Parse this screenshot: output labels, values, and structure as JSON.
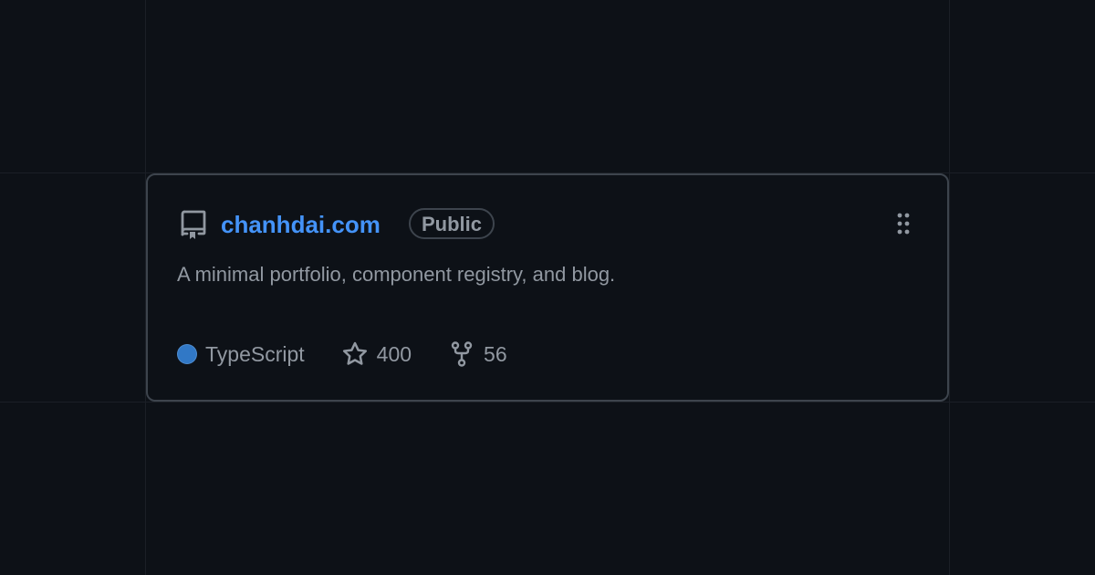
{
  "repo": {
    "name": "chanhdai.com",
    "visibility": "Public",
    "description": "A minimal portfolio, component registry, and blog.",
    "language": "TypeScript",
    "stars": "400",
    "forks": "56"
  },
  "colors": {
    "background": "#0d1117",
    "accent_link": "#4493f8",
    "muted_text": "#9198a1",
    "border": "#3d444d",
    "language_dot": "#3178c6"
  },
  "icons": {
    "repo": "repo-icon",
    "drag": "drag-handle-icon",
    "star": "star-icon",
    "fork": "fork-icon"
  }
}
